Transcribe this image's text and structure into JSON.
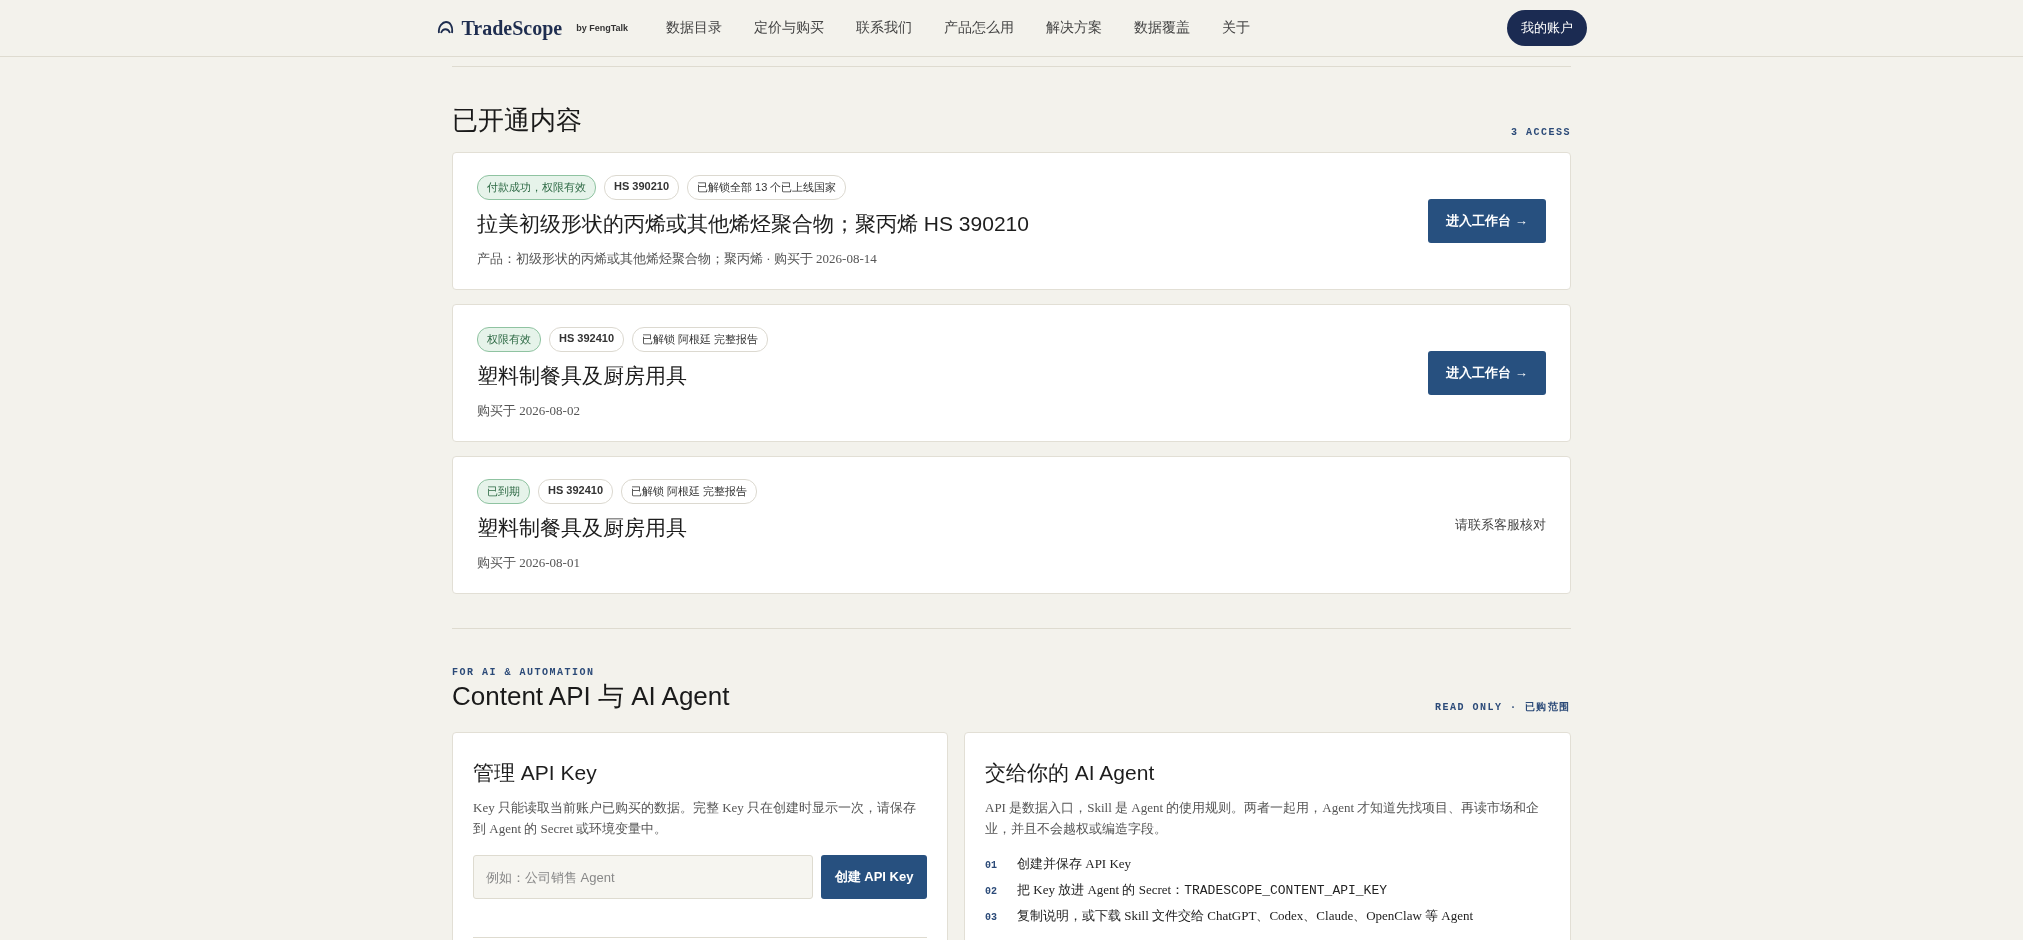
{
  "nav": {
    "brand": "TradeScope",
    "brand_sub": "by FengTalk",
    "links": [
      "数据目录",
      "定价与购买",
      "联系我们",
      "产品怎么用",
      "解决方案",
      "数据覆盖",
      "关于"
    ],
    "account_button": "我的账户"
  },
  "access": {
    "title": "已开通内容",
    "count": "3 ACCESS",
    "items": [
      {
        "badges": [
          {
            "label": "付款成功，权限有效",
            "kind": "status"
          },
          {
            "label": "HS 390210",
            "kind": "code"
          },
          {
            "label": "已解锁全部 13 个已上线国家",
            "kind": "scope"
          }
        ],
        "title": "拉美初级形状的丙烯或其他烯烃聚合物；聚丙烯 HS 390210",
        "meta": "产品：初级形状的丙烯或其他烯烃聚合物；聚丙烯 · 购买于 2026-08-14",
        "action": {
          "kind": "button",
          "label": "进入工作台 →"
        }
      },
      {
        "badges": [
          {
            "label": "权限有效",
            "kind": "status"
          },
          {
            "label": "HS 392410",
            "kind": "code"
          },
          {
            "label": "已解锁 阿根廷 完整报告",
            "kind": "scope"
          }
        ],
        "title": "塑料制餐具及厨房用具",
        "meta": "购买于 2026-08-02",
        "action": {
          "kind": "button",
          "label": "进入工作台 →"
        }
      },
      {
        "badges": [
          {
            "label": "已到期",
            "kind": "status"
          },
          {
            "label": "HS 392410",
            "kind": "code"
          },
          {
            "label": "已解锁 阿根廷 完整报告",
            "kind": "scope"
          }
        ],
        "title": "塑料制餐具及厨房用具",
        "meta": "购买于 2026-08-01",
        "action": {
          "kind": "note",
          "label": "请联系客服核对"
        }
      }
    ]
  },
  "api": {
    "eyebrow": "FOR AI & AUTOMATION",
    "title": "Content API 与 AI Agent",
    "scope_label": "READ ONLY · 已购范围",
    "key_card": {
      "title": "管理 API Key",
      "description": "Key 只能读取当前账户已购买的数据。完整 Key 只在创建时显示一次，请保存到 Agent 的 Secret 或环境变量中。",
      "input": {
        "placeholder": "例如：公司销售 Agent"
      },
      "button": "创建 API Key"
    },
    "agent_card": {
      "title": "交给你的 AI Agent",
      "description": "API 是数据入口，Skill 是 Agent 的使用规则。两者一起用，Agent 才知道先找项目、再读市场和企业，并且不会越权或编造字段。",
      "steps": [
        {
          "number": "01",
          "text": "创建并保存 API Key"
        },
        {
          "number": "02",
          "text": "把 Key 放进 Agent 的 Secret：",
          "code": "TRADESCOPE_CONTENT_API_KEY"
        },
        {
          "number": "03",
          "text": "复制说明，或下载 Skill 文件交给 ChatGPT、Codex、Claude、OpenClaw 等 Agent"
        }
      ]
    }
  }
}
